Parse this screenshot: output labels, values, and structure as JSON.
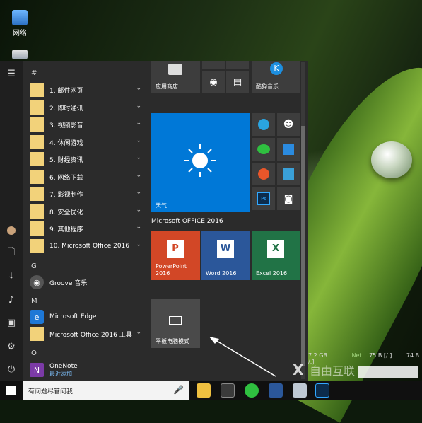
{
  "desktop": {
    "icons": [
      {
        "label": "网络",
        "icon": "network-icon"
      },
      {
        "label": "",
        "icon": "recycle-bin-icon"
      }
    ],
    "stats": {
      "disk": "7.2 GB",
      "net_label": "Net",
      "net_val": "75 B",
      "net_unit": "[/.]",
      "right_val": "74 B",
      "right_unit": "/.]"
    }
  },
  "start": {
    "rail": [
      "hamburger-icon",
      "user-avatar-icon",
      "document-icon",
      "download-icon",
      "music-icon",
      "picture-icon",
      "settings-icon",
      "power-icon"
    ],
    "groups": [
      {
        "header": "#"
      },
      {
        "header": "G"
      },
      {
        "header": "M"
      },
      {
        "header": "O"
      }
    ],
    "apps": [
      {
        "label": "1. 邮件网页"
      },
      {
        "label": "2. 即时通讯"
      },
      {
        "label": "3. 视频影音"
      },
      {
        "label": "4. 休闲游戏"
      },
      {
        "label": "5. 财经资讯"
      },
      {
        "label": "6. 网络下载"
      },
      {
        "label": "7. 影视制作"
      },
      {
        "label": "8. 安全优化"
      },
      {
        "label": "9. 其他程序"
      },
      {
        "label": "10. Microsoft Office 2016"
      },
      {
        "label": "Groove 音乐"
      },
      {
        "label": "Microsoft Edge"
      },
      {
        "label": "Microsoft Office 2016 工具"
      },
      {
        "label": "OneNote",
        "sub": "最近添加"
      }
    ],
    "tiles": {
      "store": "应用商店",
      "kugou": "酷狗音乐",
      "weather": "天气",
      "office_group": "Microsoft OFFICE 2016",
      "powerpoint": "PowerPoint\n2016",
      "word": "Word 2016",
      "excel": "Excel 2016",
      "tablet": "平板电脑模式"
    }
  },
  "taskbar": {
    "search_placeholder": "有问题尽管问我",
    "apps": [
      "file-explorer-icon",
      "calculator-icon",
      "browser-360-icon",
      "word-icon",
      "photo-viewer-icon",
      "photoshop-icon"
    ]
  },
  "colors": {
    "accent": "#0078d7",
    "ppt": "#d24726",
    "word": "#2b579a",
    "excel": "#217346",
    "start_bg": "#2b2b2b"
  }
}
